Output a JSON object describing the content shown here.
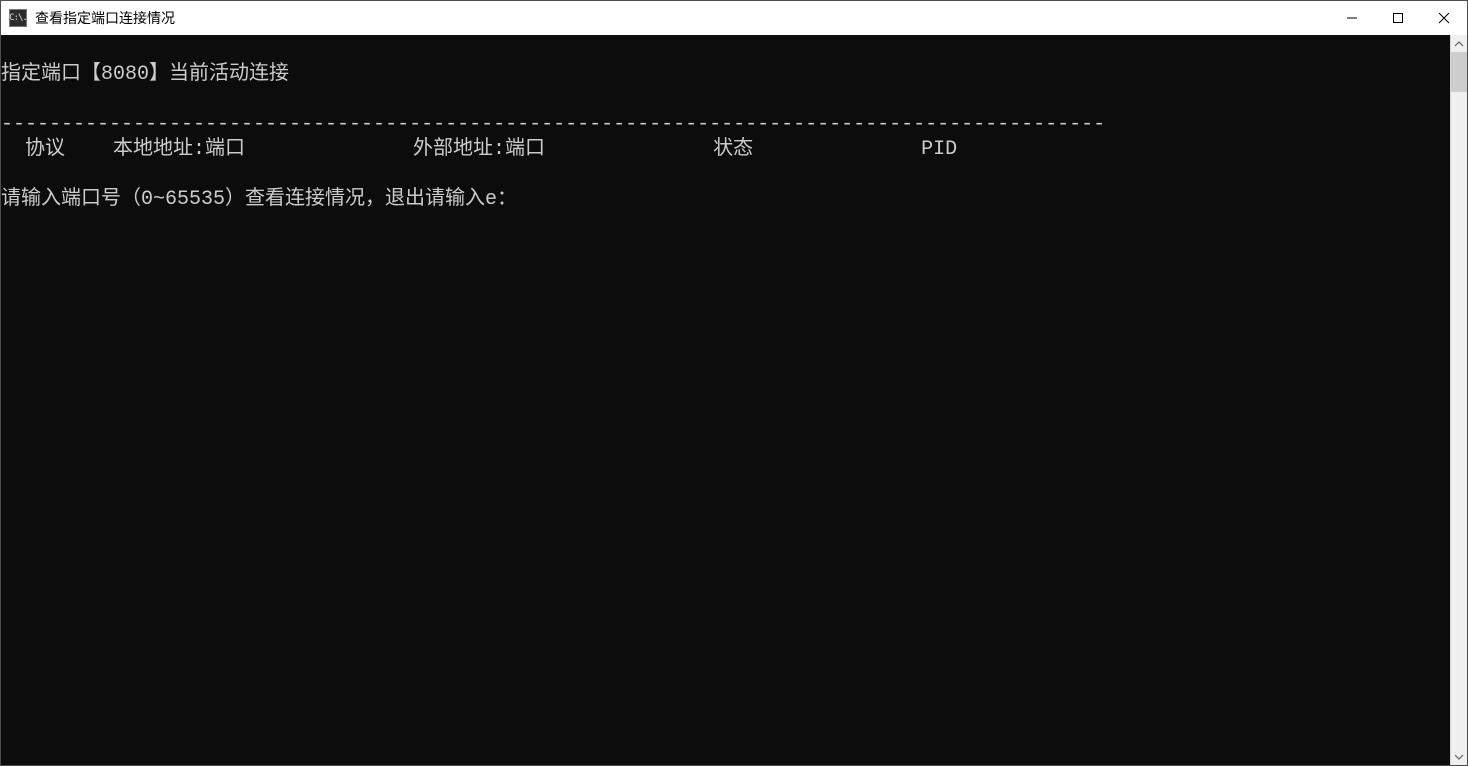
{
  "window": {
    "title": "查看指定端口连接情况",
    "app_icon_text": "C:\\."
  },
  "console": {
    "status_line": "指定端口【8080】当前活动连接",
    "blank": "",
    "divider": "--------------------------------------------------------------------------------------------",
    "header_line": "  协议    本地地址:端口              外部地址:端口              状态              PID",
    "prompt_line": "请输入端口号（0~65535）查看连接情况，退出请输入e："
  }
}
